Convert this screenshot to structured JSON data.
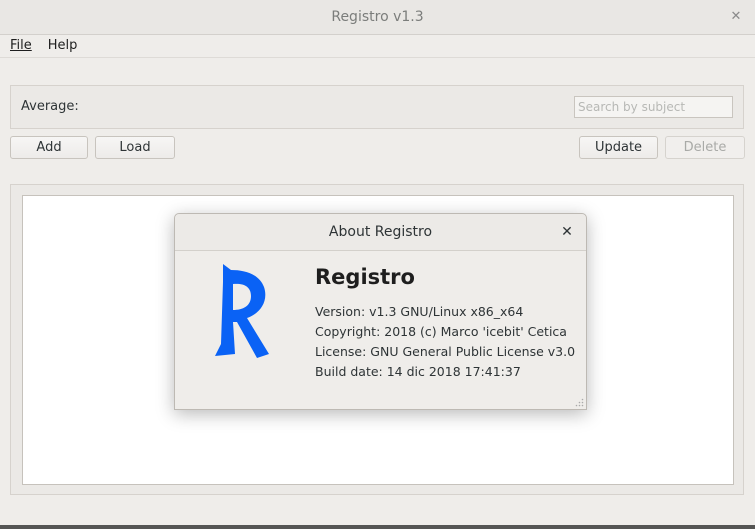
{
  "window": {
    "title": "Registro v1.3",
    "close_glyph": "✕"
  },
  "menu": {
    "file": "File",
    "help": "Help"
  },
  "panel": {
    "average_label": "Average:",
    "search_placeholder": "Search by subject"
  },
  "buttons": {
    "add": "Add",
    "load": "Load",
    "update": "Update",
    "delete": "Delete"
  },
  "about": {
    "title": "About Registro",
    "close_glyph": "✕",
    "app_name": "Registro",
    "version": "Version: v1.3 GNU/Linux x86_x64",
    "copyright": "Copyright: 2018 (c) Marco 'icebit' Cetica",
    "license": "License: GNU General Public License v3.0",
    "build_date": "Build date: 14 dic 2018 17:41:37",
    "logo_icon": "registro-r-logo",
    "logo_color": "#0a62f5"
  }
}
